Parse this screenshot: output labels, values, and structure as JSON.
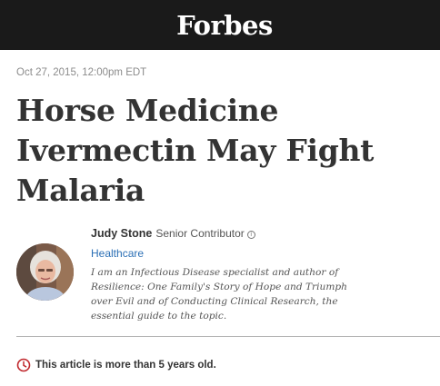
{
  "header": {
    "logo_text": "Forbes"
  },
  "article": {
    "dateline": "Oct 27, 2015, 12:00pm EDT",
    "headline_lines": [
      "Horse Medicine",
      "Ivermectin May Fight",
      "Malaria"
    ]
  },
  "author": {
    "name": "Judy Stone",
    "role": "Senior Contributor",
    "info_icon": "info-icon",
    "category": "Healthcare",
    "bio_lines": [
      "I am an Infectious Disease specialist and author of",
      "Resilience: One Family's Story of Hope and Triumph",
      "over Evil and of Conducting Clinical Research, the",
      "essential guide to the topic."
    ]
  },
  "notice": {
    "icon": "clock-icon",
    "text": "This article is more than 5 years old."
  },
  "colors": {
    "header_bg": "#1a1a1a",
    "link_blue": "#2b6fb5",
    "notice_red": "#c0282d"
  }
}
